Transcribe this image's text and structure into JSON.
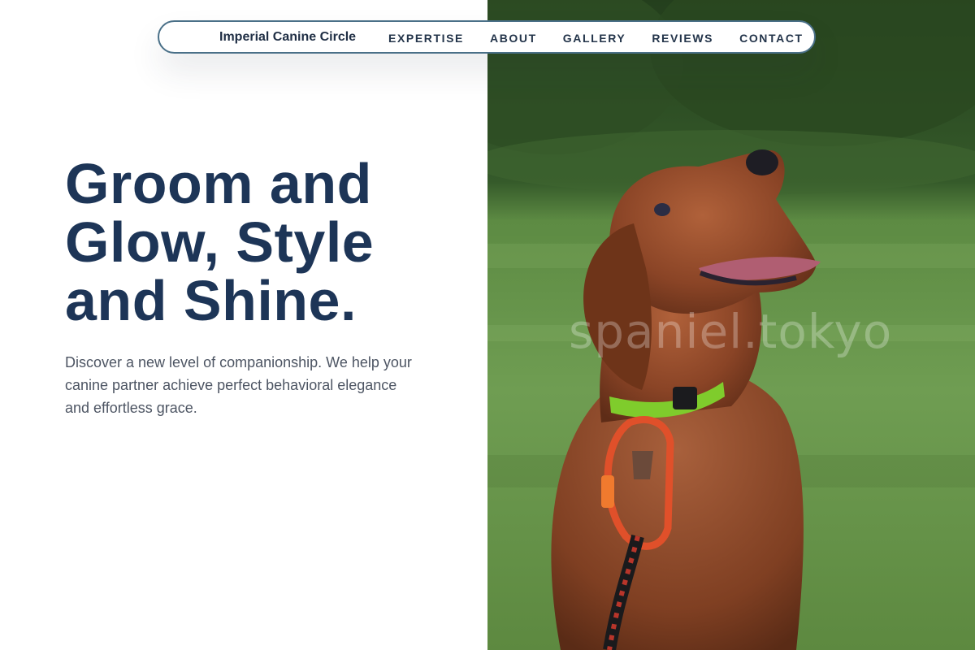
{
  "nav": {
    "brand": "Imperial Canine Circle",
    "links": [
      "EXPERTISE",
      "ABOUT",
      "GALLERY",
      "REVIEWS",
      "CONTACT"
    ]
  },
  "hero": {
    "headline_lines": [
      "Groom and",
      "Glow, Style",
      "and Shine."
    ],
    "description_lines": [
      "Discover a new level of companionship. We help your",
      "canine partner achieve perfect behavioral elegance",
      "and effortless grace."
    ],
    "image": {
      "subject": "dog-photo",
      "watermark": "spaniel.tokyo"
    }
  },
  "colors": {
    "heading": "#1d3557",
    "body_text": "#4d5563",
    "nav_border": "#4a7088",
    "nav_text": "#23344a"
  }
}
